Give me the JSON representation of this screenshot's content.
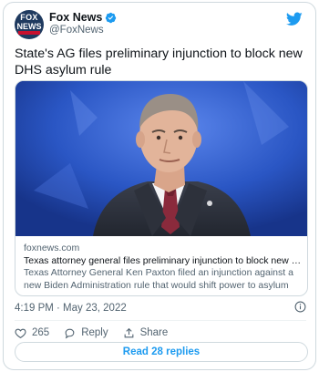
{
  "account": {
    "display_name": "Fox News",
    "handle": "@FoxNews",
    "avatar_text_top": "FOX",
    "avatar_text_bottom": "NEWS",
    "verified": true
  },
  "tweet": {
    "text": "State's AG files preliminary injunction to block new DHS asylum rule",
    "timestamp": "4:19 PM · May 23, 2022"
  },
  "card": {
    "domain": "foxnews.com",
    "title": "Texas attorney general files preliminary injunction to block new DHS asyl...",
    "description": "Texas Attorney General Ken Paxton filed an injunction against a new Biden Administration rule that would shift power to asylum officers more pow..."
  },
  "actions": {
    "like_count": "265",
    "reply_label": "Reply",
    "share_label": "Share"
  },
  "read_replies_label": "Read 28 replies",
  "colors": {
    "accent": "#1d9bf0",
    "text": "#0f1419",
    "muted": "#536471",
    "border": "#cfd9de",
    "card_image_bg": "#2a59c9"
  },
  "icons": [
    "fox-news-avatar",
    "verified-badge-icon",
    "twitter-logo-icon",
    "info-icon",
    "heart-icon",
    "reply-icon",
    "share-icon"
  ]
}
